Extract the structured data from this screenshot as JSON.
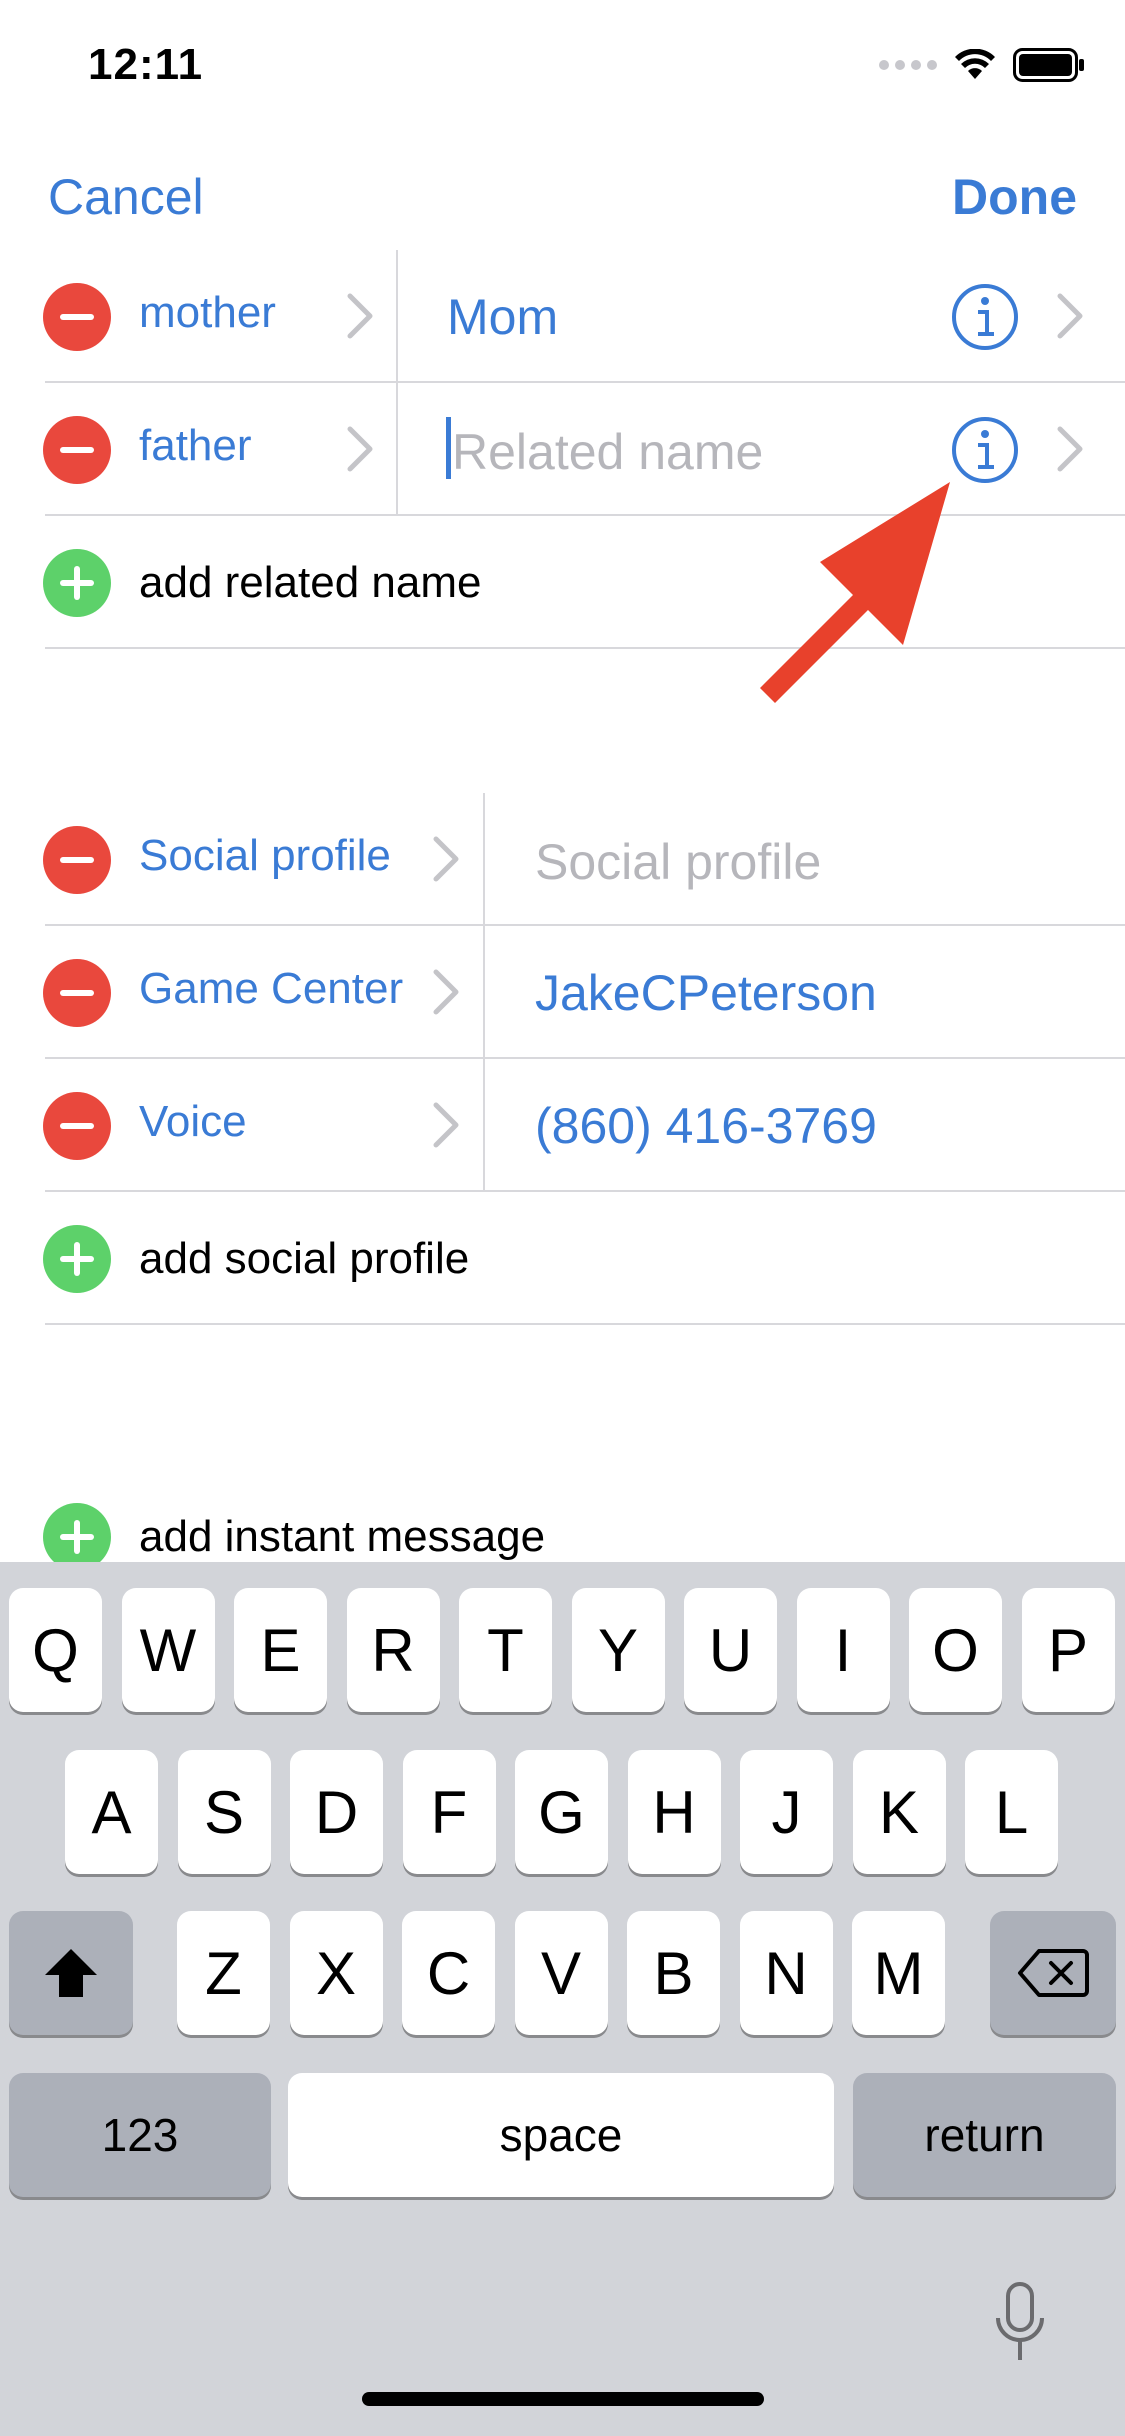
{
  "status": {
    "time": "12:11"
  },
  "nav": {
    "cancel": "Cancel",
    "done": "Done"
  },
  "related": [
    {
      "label": "mother",
      "value": "Mom"
    },
    {
      "label": "father",
      "value": "",
      "placeholder": "Related name"
    }
  ],
  "add_related": "add related name",
  "social": [
    {
      "label": "Social profile",
      "value": "",
      "placeholder": "Social profile"
    },
    {
      "label": "Game Center",
      "value": "JakeCPeterson"
    },
    {
      "label": "Voice",
      "value": "(860) 416-3769"
    }
  ],
  "add_social": "add social profile",
  "add_im": "add instant message",
  "keyboard": {
    "row1": [
      "Q",
      "W",
      "E",
      "R",
      "T",
      "Y",
      "U",
      "I",
      "O",
      "P"
    ],
    "row2": [
      "A",
      "S",
      "D",
      "F",
      "G",
      "H",
      "J",
      "K",
      "L"
    ],
    "row3": [
      "Z",
      "X",
      "C",
      "V",
      "B",
      "N",
      "M"
    ],
    "numbers": "123",
    "space": "space",
    "return": "return"
  },
  "colors": {
    "accent": "#3a7bd5",
    "delete": "#e9483d",
    "add": "#5dd16a",
    "annotation_arrow": "#e8412c"
  }
}
